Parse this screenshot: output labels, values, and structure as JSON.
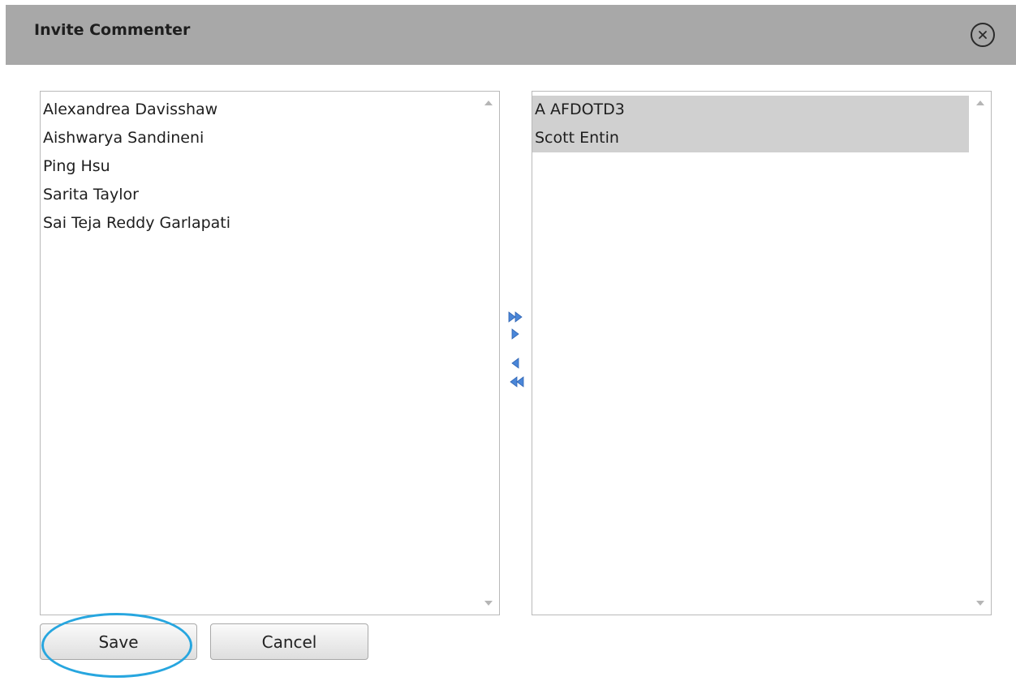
{
  "dialog": {
    "title": "Invite Commenter",
    "close_icon": "close-circle-icon"
  },
  "available_list": {
    "items": [
      {
        "label": "Alexandrea Davisshaw"
      },
      {
        "label": "Aishwarya Sandineni"
      },
      {
        "label": "Ping Hsu"
      },
      {
        "label": "Sarita Taylor"
      },
      {
        "label": "Sai Teja Reddy Garlapati"
      }
    ]
  },
  "selected_list": {
    "items": [
      {
        "label": "A AFDOTD3",
        "selected": true
      },
      {
        "label": "Scott Entin",
        "selected": true
      }
    ]
  },
  "transfer_controls": {
    "move_all_right_icon": "double-arrow-right-icon",
    "move_right_icon": "arrow-right-icon",
    "move_left_icon": "arrow-left-icon",
    "move_all_left_icon": "double-arrow-left-icon",
    "arrow_color": "#4a86d8"
  },
  "footer": {
    "save_label": "Save",
    "cancel_label": "Cancel",
    "annotation_color": "#27a6df"
  }
}
